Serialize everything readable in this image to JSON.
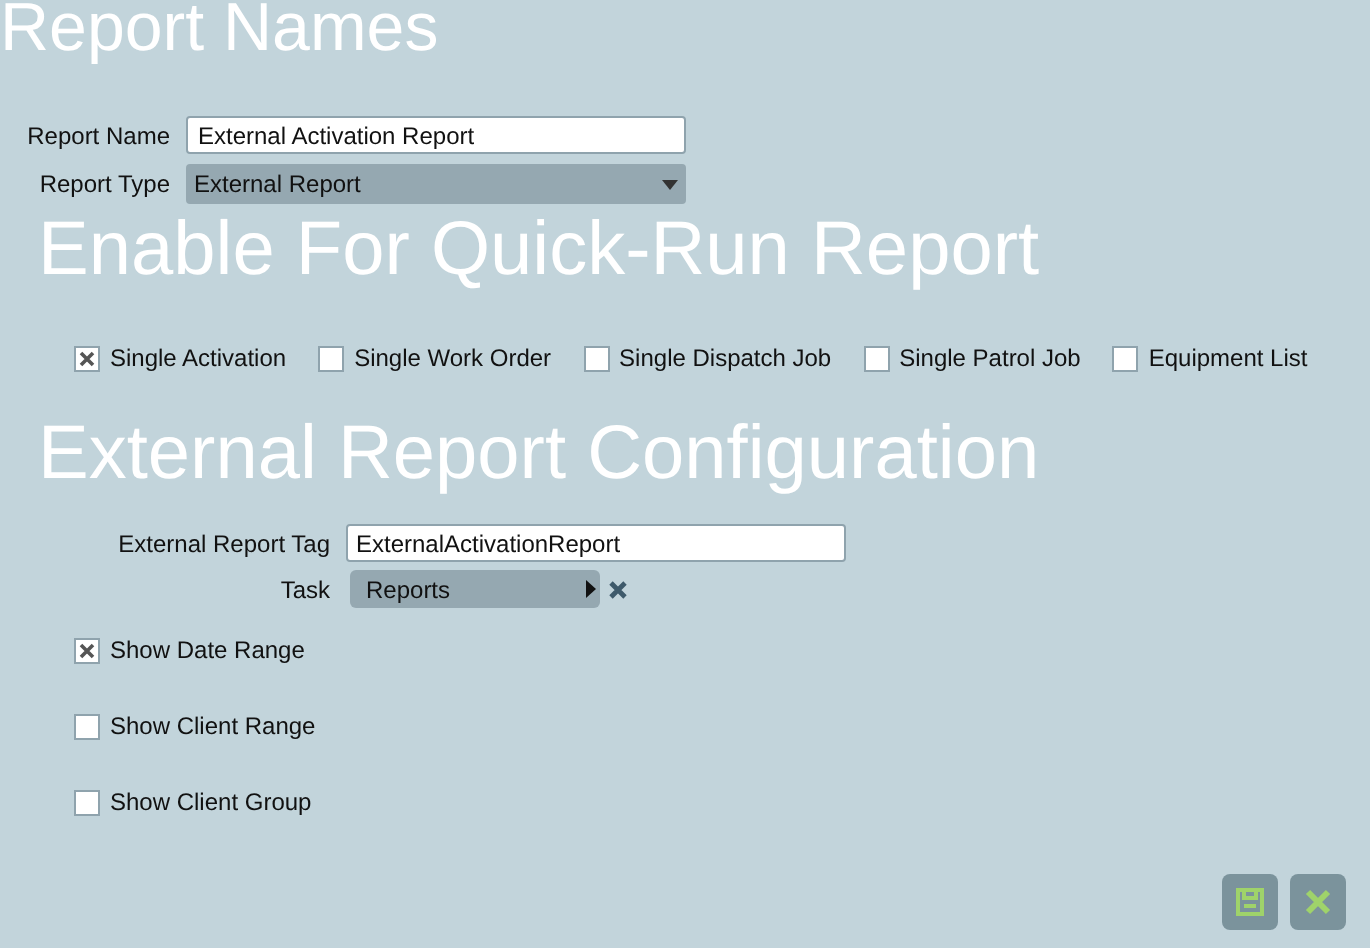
{
  "title": "Report Names",
  "report_name": {
    "label": "Report Name",
    "value": "External Activation Report"
  },
  "report_type": {
    "label": "Report Type",
    "value": "External Report"
  },
  "quick_run": {
    "heading": "Enable For Quick-Run Report",
    "options": [
      {
        "label": "Single Activation",
        "checked": true
      },
      {
        "label": "Single Work Order",
        "checked": false
      },
      {
        "label": "Single Dispatch Job",
        "checked": false
      },
      {
        "label": "Single Patrol Job",
        "checked": false
      },
      {
        "label": "Equipment List",
        "checked": false
      }
    ]
  },
  "external_config": {
    "heading": "External Report Configuration",
    "tag": {
      "label": "External Report Tag",
      "value": "ExternalActivationReport"
    },
    "task": {
      "label": "Task",
      "value": "Reports"
    },
    "options": [
      {
        "label": "Show Date Range",
        "checked": true
      },
      {
        "label": "Show Client Range",
        "checked": false
      },
      {
        "label": "Show Client Group",
        "checked": false
      }
    ]
  }
}
